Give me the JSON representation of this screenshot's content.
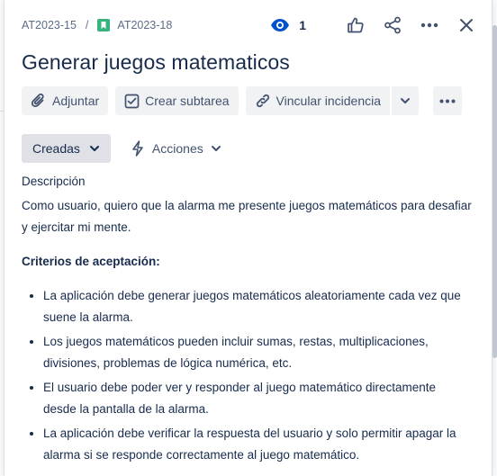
{
  "breadcrumb": {
    "parent_key": "AT2023-15",
    "separator": "/",
    "issue_key": "AT2023-18",
    "issue_type_icon": "story-bookmark-icon",
    "issue_type_color": "#36b37e"
  },
  "toolbar": {
    "watch_count": "1",
    "icons": [
      "eye-icon",
      "thumbs-up-icon",
      "share-icon",
      "more-icon",
      "close-icon"
    ]
  },
  "issue": {
    "title": "Generar juegos matematicos"
  },
  "buttons": {
    "attach": "Adjuntar",
    "subtask": "Crear subtarea",
    "link": "Vincular incidencia"
  },
  "status": {
    "label": "Creadas"
  },
  "actions": {
    "label": "Acciones"
  },
  "description": {
    "label": "Descripción",
    "text": "Como usuario, quiero que la alarma me presente juegos matemáticos para desafiar y ejercitar mi mente.",
    "criteria_heading": "Criterios de aceptación:",
    "criteria": [
      "La aplicación debe generar juegos matemáticos aleatoriamente cada vez que suene la alarma.",
      "Los juegos matemáticos pueden incluir sumas, restas, multiplicaciones, divisiones, problemas de lógica numérica, etc.",
      "El usuario debe poder ver y responder al juego matemático directamente desde la pantalla de la alarma.",
      "La aplicación debe verificar la respuesta del usuario y solo permitir apagar la alarma si se responde correctamente al juego matemático."
    ]
  },
  "colors": {
    "text": "#172b4d",
    "muted": "#5e6c84",
    "button_bg": "#f1f2f4",
    "status_bg": "#dfe1e6",
    "watch_accent": "#0052cc"
  }
}
